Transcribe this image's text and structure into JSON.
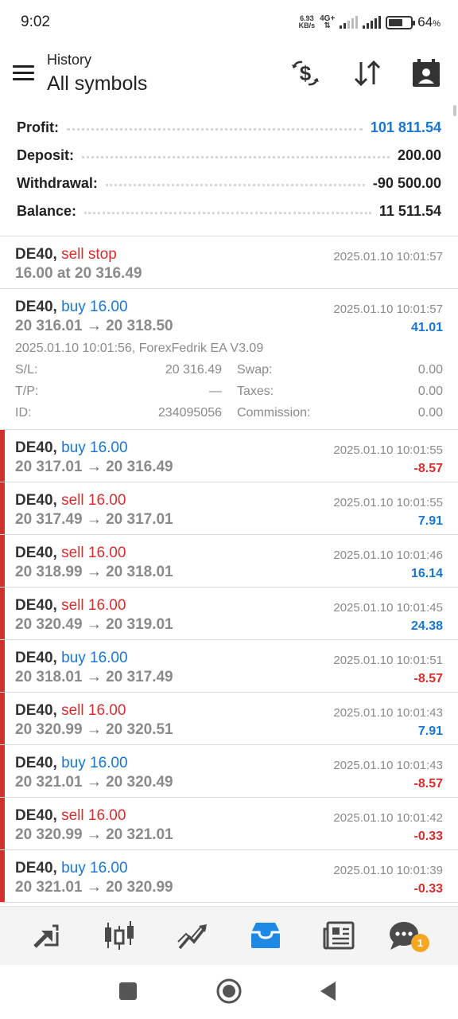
{
  "status_bar": {
    "time": "9:02",
    "net_speed_value": "6.93",
    "net_speed_unit": "KB/s",
    "network_type": "4G+",
    "battery_percent": "64",
    "battery_unit": "%",
    "battery_level": 0.64
  },
  "header": {
    "subtitle": "History",
    "title": "All symbols",
    "icons": [
      "currency-exchange-icon",
      "sort-icon",
      "calendar-icon"
    ]
  },
  "summary": {
    "profit_label": "Profit:",
    "profit_value": "101 811.54",
    "deposit_label": "Deposit:",
    "deposit_value": "200.00",
    "withdrawal_label": "Withdrawal:",
    "withdrawal_value": "-90 500.00",
    "balance_label": "Balance:",
    "balance_value": "11 511.54"
  },
  "order": {
    "symbol": "DE40,",
    "side": "sell stop",
    "detail": "16.00 at 20 316.49",
    "time": "2025.01.10 10:01:57"
  },
  "expanded_deal": {
    "symbol": "DE40,",
    "side": "buy 16.00",
    "open": "20 316.01",
    "arrow": "→",
    "close": "20 318.50",
    "time": "2025.01.10 10:01:57",
    "profit": "41.01",
    "comment": "2025.01.10 10:01:56, ForexFedrik EA V3.09",
    "sl_label": "S/L:",
    "sl_value": "20 316.49",
    "swap_label": "Swap:",
    "swap_value": "0.00",
    "tp_label": "T/P:",
    "tp_value": "—",
    "taxes_label": "Taxes:",
    "taxes_value": "0.00",
    "id_label": "ID:",
    "id_value": "234095056",
    "commission_label": "Commission:",
    "commission_value": "0.00"
  },
  "deals": [
    {
      "symbol": "DE40,",
      "side": "buy 16.00",
      "open": "20 317.01",
      "arrow": "→",
      "close": "20 316.49",
      "time": "2025.01.10 10:01:55",
      "profit": "-8.57"
    },
    {
      "symbol": "DE40,",
      "side": "sell 16.00",
      "open": "20 317.49",
      "arrow": "→",
      "close": "20 317.01",
      "time": "2025.01.10 10:01:55",
      "profit": "7.91"
    },
    {
      "symbol": "DE40,",
      "side": "sell 16.00",
      "open": "20 318.99",
      "arrow": "→",
      "close": "20 318.01",
      "time": "2025.01.10 10:01:46",
      "profit": "16.14"
    },
    {
      "symbol": "DE40,",
      "side": "sell 16.00",
      "open": "20 320.49",
      "arrow": "→",
      "close": "20 319.01",
      "time": "2025.01.10 10:01:45",
      "profit": "24.38"
    },
    {
      "symbol": "DE40,",
      "side": "buy 16.00",
      "open": "20 318.01",
      "arrow": "→",
      "close": "20 317.49",
      "time": "2025.01.10 10:01:51",
      "profit": "-8.57"
    },
    {
      "symbol": "DE40,",
      "side": "sell 16.00",
      "open": "20 320.99",
      "arrow": "→",
      "close": "20 320.51",
      "time": "2025.01.10 10:01:43",
      "profit": "7.91"
    },
    {
      "symbol": "DE40,",
      "side": "buy 16.00",
      "open": "20 321.01",
      "arrow": "→",
      "close": "20 320.49",
      "time": "2025.01.10 10:01:43",
      "profit": "-8.57"
    },
    {
      "symbol": "DE40,",
      "side": "sell 16.00",
      "open": "20 320.99",
      "arrow": "→",
      "close": "20 321.01",
      "time": "2025.01.10 10:01:42",
      "profit": "-0.33"
    },
    {
      "symbol": "DE40,",
      "side": "buy 16.00",
      "open": "20 321.01",
      "arrow": "→",
      "close": "20 320.99",
      "time": "2025.01.10 10:01:39",
      "profit": "-0.33"
    }
  ],
  "bottom_nav": {
    "items": [
      "trade-icon",
      "quotes-icon",
      "chart-icon",
      "history-icon",
      "news-icon",
      "chat-icon"
    ],
    "chat_badge": "1",
    "active": "history-icon"
  },
  "system_nav": [
    "recent-apps-icon",
    "home-icon",
    "back-icon"
  ],
  "colors": {
    "buy": "#1976d2",
    "sell": "#d32f2f",
    "accent": "#1976d2",
    "badge": "#f5a623"
  }
}
